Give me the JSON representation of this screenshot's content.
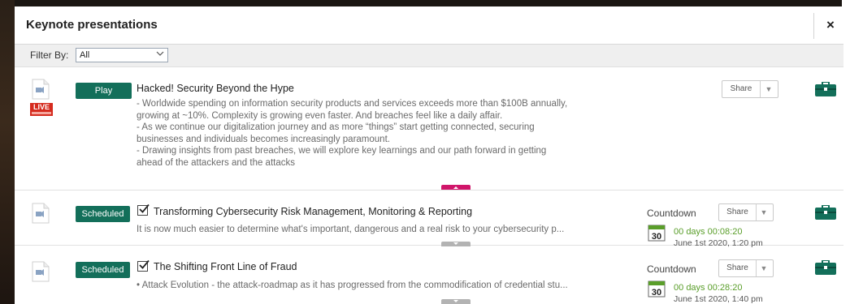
{
  "header": {
    "title": "Keynote presentations",
    "close": "×"
  },
  "filter": {
    "label": "Filter By:",
    "value": "All"
  },
  "colors": {
    "accent_green": "#136f5a",
    "live_red": "#d52b1e",
    "expander_pink": "#d0156a",
    "countdown_green": "#5a9e2a"
  },
  "items": [
    {
      "button": "Play",
      "live_label": "LIVE",
      "title": "Hacked! Security Beyond the Hype",
      "description": [
        "- Worldwide spending on information security products and services exceeds more than $100B annually,",
        "growing at ~10%. Complexity is growing even faster. And breaches feel like a daily affair.",
        "- As we continue our digitalization journey and as more “things” start getting connected, securing",
        "businesses and individuals becomes increasingly paramount.",
        "- Drawing insights from past breaches, we will explore key learnings and our path forward in getting",
        "ahead of the attackers and the attacks"
      ],
      "share": "Share",
      "icons": {
        "doc": "video-document-icon",
        "live": "live-badge-icon",
        "briefcase": "briefcase-icon",
        "expander": "collapse-arrow-icon"
      }
    },
    {
      "button": "Scheduled",
      "checked": true,
      "title": "Transforming Cybersecurity Risk Management, Monitoring & Reporting",
      "description": [
        "It is now much easier to determine what's important, dangerous and a real risk to your cybersecurity p..."
      ],
      "countdown_label": "Countdown",
      "share": "Share",
      "days_value": "00",
      "days_unit": "days",
      "time": "00:08:20",
      "calendar_day": "30",
      "date": "June 1st 2020, 1:20 pm",
      "icons": {
        "doc": "video-document-icon",
        "calendar": "calendar-icon",
        "briefcase": "briefcase-icon",
        "expander": "expand-arrow-icon"
      }
    },
    {
      "button": "Scheduled",
      "checked": true,
      "title": "The Shifting Front Line of Fraud",
      "description": [
        "• Attack Evolution - the attack-roadmap as it has progressed from the commodification of credential stu..."
      ],
      "countdown_label": "Countdown",
      "share": "Share",
      "days_value": "00",
      "days_unit": "days",
      "time": "00:28:20",
      "calendar_day": "30",
      "date": "June 1st 2020, 1:40 pm",
      "icons": {
        "doc": "video-document-icon",
        "calendar": "calendar-icon",
        "briefcase": "briefcase-icon",
        "expander": "expand-arrow-icon"
      }
    }
  ]
}
